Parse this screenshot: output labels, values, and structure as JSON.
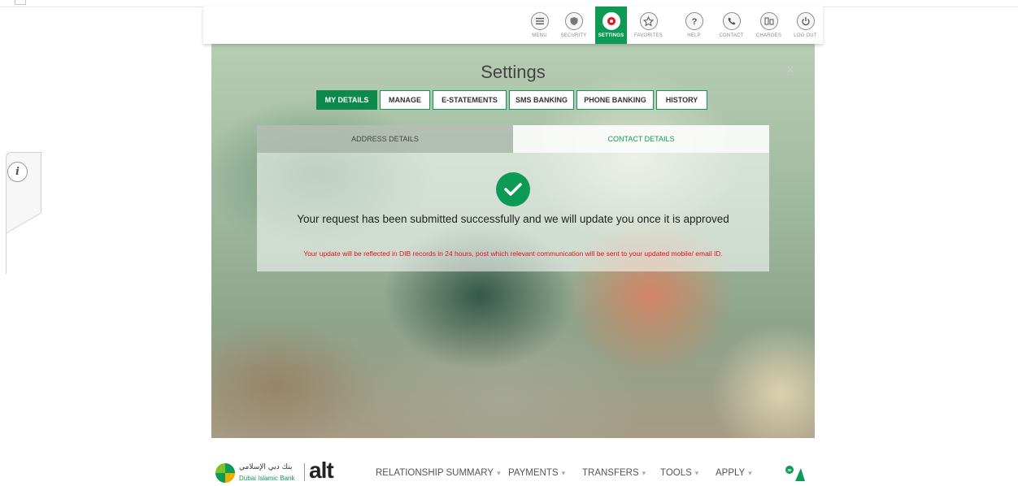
{
  "toolbar": {
    "items": [
      {
        "label": "MENU",
        "icon": "menu-icon"
      },
      {
        "label": "SECURITY",
        "icon": "shield-icon"
      },
      {
        "label": "SETTINGS",
        "icon": "gear-icon",
        "active": true
      },
      {
        "label": "FAVORITES",
        "icon": "star-icon"
      },
      {
        "label": "HELP",
        "icon": "question-icon"
      },
      {
        "label": "CONTACT",
        "icon": "phone-icon"
      },
      {
        "label": "CHARGES",
        "icon": "charges-icon"
      },
      {
        "label": "LOG OUT",
        "icon": "power-icon"
      }
    ]
  },
  "settings": {
    "title": "Settings",
    "close_symbol": "×",
    "tabs": [
      {
        "label": "MY DETAILS",
        "active": true
      },
      {
        "label": "MANAGE"
      },
      {
        "label": "E-STATEMENTS"
      },
      {
        "label": "SMS BANKING"
      },
      {
        "label": "PHONE BANKING"
      },
      {
        "label": "HISTORY"
      }
    ],
    "subtabs": [
      {
        "label": "ADDRESS DETAILS"
      },
      {
        "label": "CONTACT DETAILS",
        "active": true
      }
    ],
    "success_message": "Your request has been submitted successfully and we will update you once it is approved",
    "note": "Your update will be reflected in DIB records in 24 hours, post which relevant communication will be sent to your updated mobile/ email ID."
  },
  "info_tab": {
    "symbol": "i"
  },
  "bottom_nav": {
    "bank_name_arabic": "بنك دبي الإسلامي",
    "bank_name_english": "Dubai Islamic Bank",
    "brand": "alt",
    "items": [
      {
        "label": "RELATIONSHIP SUMMARY"
      },
      {
        "label": "PAYMENTS"
      },
      {
        "label": "TRANSFERS"
      },
      {
        "label": "TOOLS"
      },
      {
        "label": "APPLY"
      }
    ]
  },
  "colors": {
    "accent": "#0d9a55",
    "warning_text": "#e3141b"
  }
}
